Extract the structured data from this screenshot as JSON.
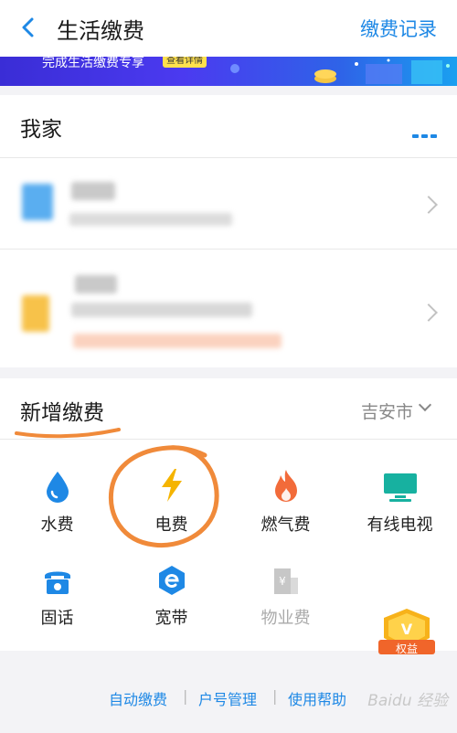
{
  "header": {
    "title": "生活缴费",
    "records_label": "缴费记录"
  },
  "banner": {
    "text": "完成生活缴费专享",
    "button": "查看详情"
  },
  "home": {
    "title": "我家"
  },
  "new_payment": {
    "title": "新增缴费",
    "city": "吉安市",
    "items": [
      {
        "label": "水费",
        "icon": "water-drop-icon",
        "enabled": true
      },
      {
        "label": "电费",
        "icon": "lightning-icon",
        "enabled": true
      },
      {
        "label": "燃气费",
        "icon": "flame-icon",
        "enabled": true
      },
      {
        "label": "有线电视",
        "icon": "tv-icon",
        "enabled": true
      },
      {
        "label": "固话",
        "icon": "telephone-icon",
        "enabled": true
      },
      {
        "label": "宽带",
        "icon": "broadband-e-icon",
        "enabled": true
      },
      {
        "label": "物业费",
        "icon": "building-yuan-icon",
        "enabled": false
      }
    ]
  },
  "badge": {
    "label": "权益"
  },
  "footer": {
    "links": [
      "自动缴费",
      "户号管理",
      "使用帮助"
    ]
  },
  "watermark": "Baidu 经验",
  "colors": {
    "accent": "#1e88e5",
    "lightning": "#f5b400",
    "flame": "#f26b3a",
    "tv": "#17b1a0",
    "annotation": "#f08a3a"
  }
}
